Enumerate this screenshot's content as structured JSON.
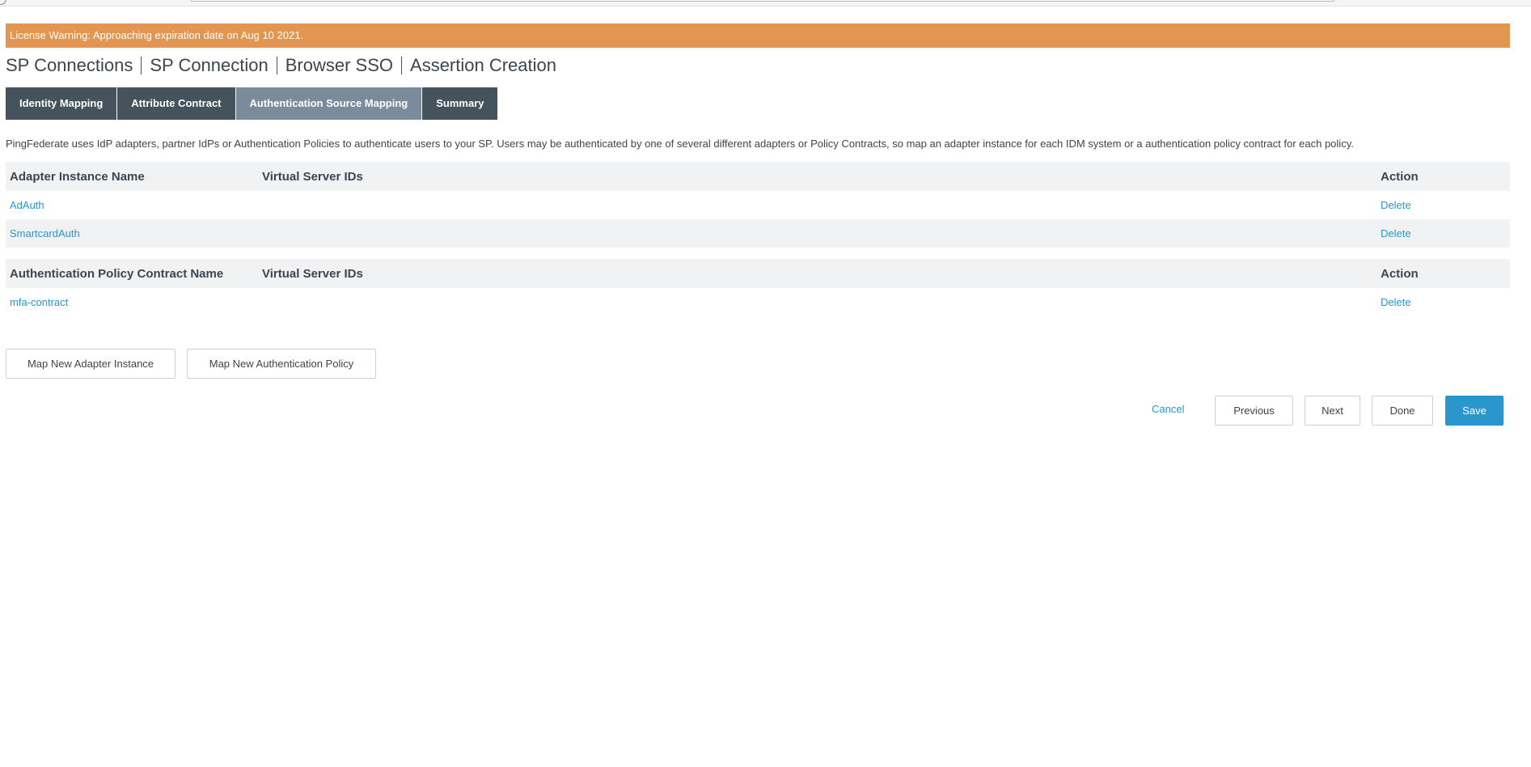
{
  "banner": {
    "text": "License Warning: Approaching expiration date on Aug 10 2021.",
    "color": "#e3964f"
  },
  "breadcrumb": [
    "SP Connections",
    "SP Connection",
    "Browser SSO",
    "Assertion Creation"
  ],
  "tabs": [
    {
      "label": "Identity Mapping",
      "active": false
    },
    {
      "label": "Attribute Contract",
      "active": false
    },
    {
      "label": "Authentication Source Mapping",
      "active": true
    },
    {
      "label": "Summary",
      "active": false
    }
  ],
  "description": "PingFederate uses IdP adapters, partner IdPs or Authentication Policies to authenticate users to your SP. Users may be authenticated by one of several different adapters or Policy Contracts, so map an adapter instance for each IDM system or a authentication policy contract for each policy.",
  "adapter_table": {
    "headers": [
      "Adapter Instance Name",
      "Virtual Server IDs",
      "Action"
    ],
    "rows": [
      {
        "name": "AdAuth",
        "virtual_server_ids": "",
        "action": "Delete"
      },
      {
        "name": "SmartcardAuth",
        "virtual_server_ids": "",
        "action": "Delete"
      }
    ]
  },
  "policy_table": {
    "headers": [
      "Authentication Policy Contract Name",
      "Virtual Server IDs",
      "Action"
    ],
    "rows": [
      {
        "name": "mfa-contract",
        "virtual_server_ids": "",
        "action": "Delete"
      }
    ]
  },
  "buttons": {
    "map_adapter": "Map New Adapter Instance",
    "map_policy": "Map New Authentication Policy",
    "cancel": "Cancel",
    "previous": "Previous",
    "next": "Next",
    "done": "Done",
    "save": "Save"
  },
  "colors": {
    "accent": "#2996cc",
    "tab_bg": "#45535c",
    "tab_active_bg": "#7b8b9c",
    "table_header_bg": "#f1f2f4"
  }
}
